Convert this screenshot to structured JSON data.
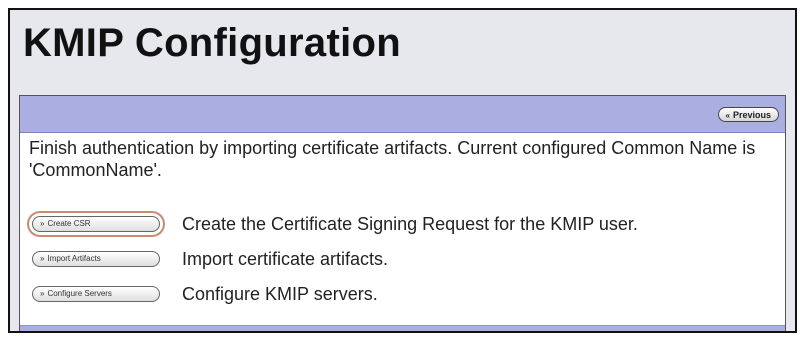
{
  "page": {
    "title": "KMIP Configuration"
  },
  "panel": {
    "previous_label": "Previous",
    "previous_icon": "double-chevron-left",
    "intro_text": "Finish authentication by importing certificate artifacts. Current configured Common Name is 'CommonName'."
  },
  "actions": [
    {
      "button_label": "Create CSR",
      "description": "Create the Certificate Signing Request for the KMIP user.",
      "highlighted": true
    },
    {
      "button_label": "Import Artifacts",
      "description": "Import certificate artifacts.",
      "highlighted": false
    },
    {
      "button_label": "Configure Servers",
      "description": "Configure KMIP servers.",
      "highlighted": false
    }
  ],
  "colors": {
    "header_bar": "#aaaee0",
    "page_background": "#e6e8ee",
    "highlight_ring": "#c88c74"
  }
}
